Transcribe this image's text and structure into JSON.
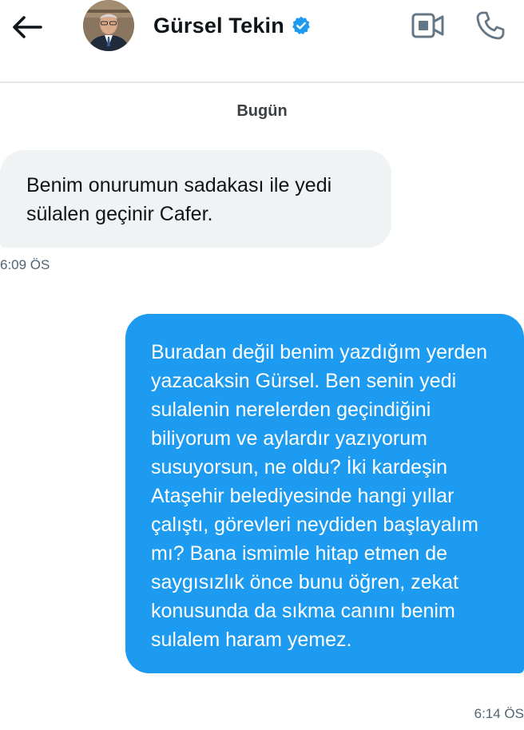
{
  "header": {
    "contact_name": "Gürsel Tekin",
    "verified": true,
    "back_icon": "arrow-left-icon",
    "video_icon": "video-camera-icon",
    "call_icon": "phone-icon",
    "accent_color": "#1d9bf0"
  },
  "conversation": {
    "date_label": "Bugün",
    "messages": [
      {
        "direction": "incoming",
        "text": "Benim onurumun sadakası ile yedi sülalen geçinir Cafer.",
        "time": "6:09 ÖS",
        "bubble_color": "#eff3f4"
      },
      {
        "direction": "outgoing",
        "text": "Buradan değil benim yazdığım yerden yazacaksin Gürsel. Ben senin yedi sulalenin nerelerden geçindiğini biliyorum ve aylardır yazıyorum susuyorsun, ne oldu? İki kardeşin Ataşehir belediyesinde hangi yıllar çalıştı, görevleri neydiden başlayalım mı? Bana ismimle hitap etmen de saygısızlık önce bunu öğren, zekat konusunda da sıkma canını benim sulalem haram yemez.",
        "time": "6:14 ÖS",
        "bubble_color": "#1d9bf0"
      }
    ]
  }
}
